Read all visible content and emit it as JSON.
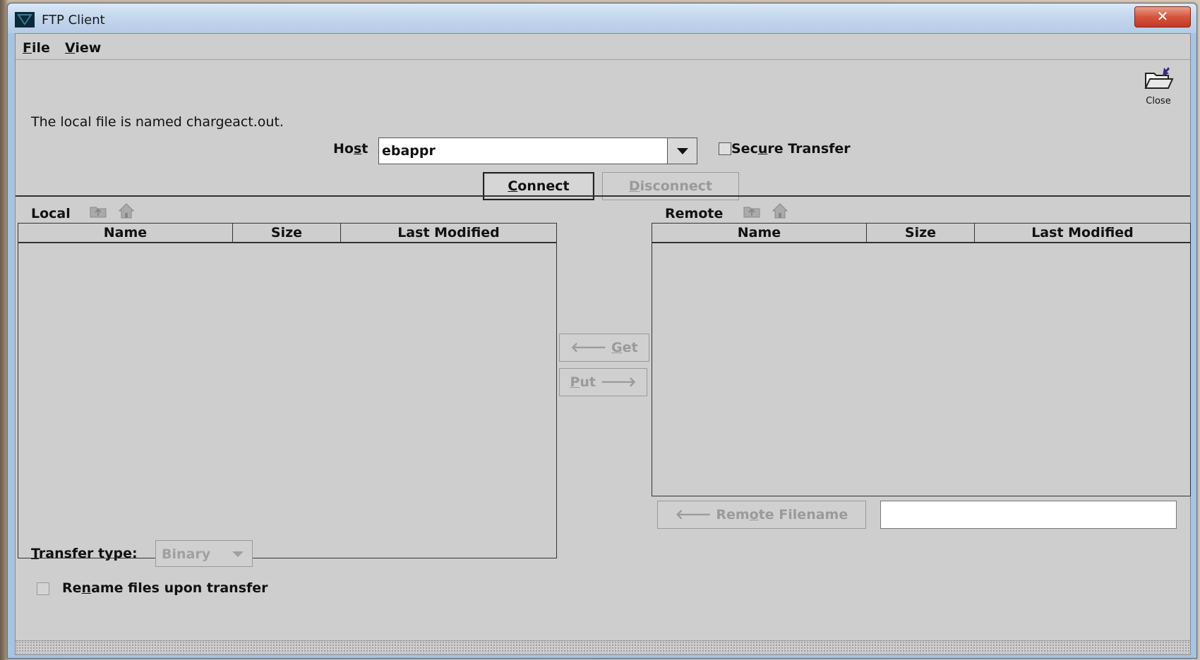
{
  "window": {
    "title": "FTP Client",
    "close_glyph": "✕"
  },
  "menu": {
    "file_label": "File",
    "view_label": "View"
  },
  "toolbar": {
    "close_label": "Close",
    "close_icon": "open-folder-icon"
  },
  "info": {
    "message": "The local file is named chargeact.out."
  },
  "connection": {
    "host_label": "Host",
    "host_value": "ebappr",
    "secure_label": "Secure Transfer",
    "secure_checked": false,
    "connect_label": "Connect",
    "disconnect_label": "Disconnect"
  },
  "local": {
    "label": "Local",
    "columns": [
      "Name",
      "Size",
      "Last Modified"
    ],
    "rows": []
  },
  "remote": {
    "label": "Remote",
    "columns": [
      "Name",
      "Size",
      "Last Modified"
    ],
    "rows": []
  },
  "transfer": {
    "get_label": "Get",
    "put_label": "Put",
    "remote_filename_label": "Remote Filename",
    "remote_filename_value": "",
    "type_label": "Transfer type:",
    "type_value": "Binary",
    "rename_label": "Rename files upon transfer",
    "rename_checked": false
  },
  "colors": {
    "panel_bg": "#cecece",
    "title_bar": "#c4d7ee",
    "close_button": "#d4553b",
    "disabled_text": "#9a9a9a"
  }
}
